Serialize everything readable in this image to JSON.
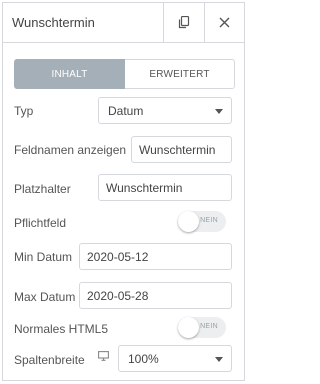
{
  "header": {
    "title": "Wunschtermin"
  },
  "icons": {
    "copy": "copy-icon",
    "close": "close-icon",
    "responsive": "desktop-monitor-icon"
  },
  "tabs": [
    {
      "label": "INHALT",
      "active": true
    },
    {
      "label": "ERWEITERT",
      "active": false
    }
  ],
  "colors": {
    "active_tab": "#a4afb7",
    "border": "#d5d8dc",
    "toggle_off": "#eceeef"
  },
  "fields": {
    "typ": {
      "label": "Typ",
      "value": "Datum"
    },
    "feldnamen": {
      "label": "Feldnamen anzeigen",
      "value": "Wunschtermin"
    },
    "platzhalter": {
      "label": "Platzhalter",
      "value": "Wunschtermin"
    },
    "pflichtfeld": {
      "label": "Pflichtfeld",
      "toggle_text": "NEIN",
      "on": false
    },
    "min_datum": {
      "label": "Min Datum",
      "value": "2020-05-12"
    },
    "max_datum": {
      "label": "Max Datum",
      "value": "2020-05-28"
    },
    "normales_html5": {
      "label": "Normales HTML5",
      "toggle_text": "NEIN",
      "on": false
    },
    "spaltenbreite": {
      "label": "Spaltenbreite",
      "value": "100%"
    }
  }
}
